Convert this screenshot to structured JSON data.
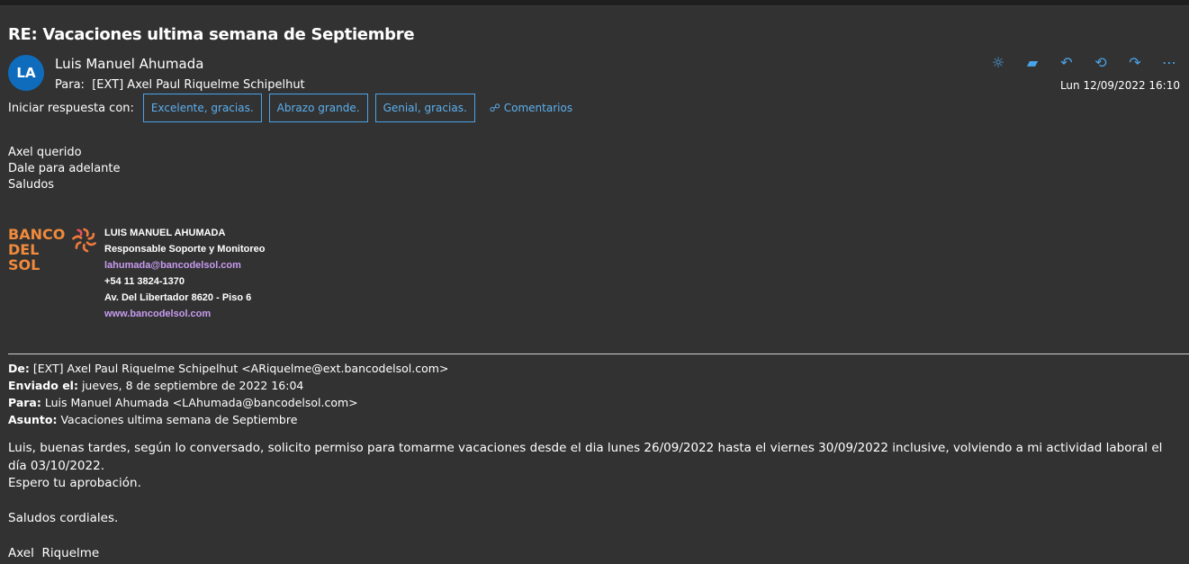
{
  "subject": "RE: Vacaciones ultima semana de Septiembre",
  "avatar_initials": "LA",
  "sender": "Luis Manuel Ahumada",
  "to_label": "Para:",
  "to": "[EXT] Axel Paul Riquelme Schipelhut",
  "date": "Lun 12/09/2022 16:10",
  "quick_reply": {
    "label": "Iniciar respuesta con:",
    "options": [
      "Excelente, gracias.",
      "Abrazo grande.",
      "Genial, gracias."
    ],
    "comments": "Comentarios"
  },
  "body_lines": [
    "Axel querido",
    "Dale para adelante",
    "Saludos"
  ],
  "signature": {
    "logo_text": "BANCO DEL SOL",
    "name": "LUIS MANUEL AHUMADA",
    "role": "Responsable Soporte y Monitoreo",
    "email": "lahumada@bancodelsol.com",
    "phone": "+54 11 3824-1370",
    "address": "Av. Del Libertador 8620 - Piso 6",
    "web": "www.bancodelsol.com"
  },
  "original": {
    "from_label": "De:",
    "from": "[EXT] Axel Paul Riquelme Schipelhut <ARiquelme@ext.bancodelsol.com>",
    "sent_label": "Enviado el:",
    "sent": "jueves, 8 de septiembre de 2022 16:04",
    "to_label": "Para:",
    "to": "Luis Manuel Ahumada <LAhumada@bancodelsol.com>",
    "subject_label": "Asunto:",
    "subject": "Vacaciones ultima semana de Septiembre",
    "body": [
      "Luis, buenas tardes, según lo conversado, solicito permiso para tomarme vacaciones desde el dia lunes 26/09/2022 hasta el viernes 30/09/2022 inclusive, volviendo a mi actividad laboral el día 03/10/2022.",
      "Espero tu aprobación.",
      "",
      "Saludos cordiales.",
      "",
      "Axel  Riquelme"
    ]
  }
}
